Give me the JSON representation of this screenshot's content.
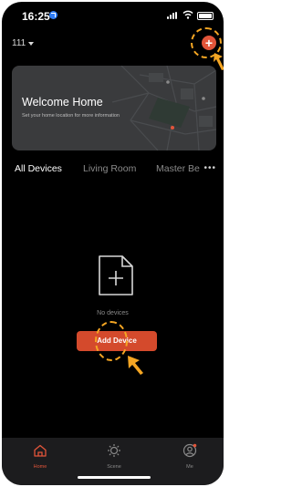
{
  "status_bar": {
    "time": "16:25"
  },
  "header": {
    "home_name": "111",
    "add_label": "+"
  },
  "welcome_card": {
    "title": "Welcome Home",
    "subtitle": "Set your home location for more information"
  },
  "tabs": [
    {
      "label": "All Devices",
      "active": true
    },
    {
      "label": "Living Room",
      "active": false
    },
    {
      "label": "Master Be",
      "active": false
    }
  ],
  "tabs_more": "•••",
  "empty_state": {
    "icon": "add-file-icon",
    "message": "No devices",
    "button_label": "Add Device"
  },
  "bottom_nav": [
    {
      "label": "Home",
      "icon": "home-icon",
      "active": true
    },
    {
      "label": "Scene",
      "icon": "scene-icon",
      "active": false
    },
    {
      "label": "Me",
      "icon": "profile-icon",
      "active": false
    }
  ],
  "colors": {
    "accent": "#e2553a",
    "button": "#d44a2c",
    "hint": "#f5a623",
    "background": "#000000",
    "card": "#3a3b3d"
  }
}
